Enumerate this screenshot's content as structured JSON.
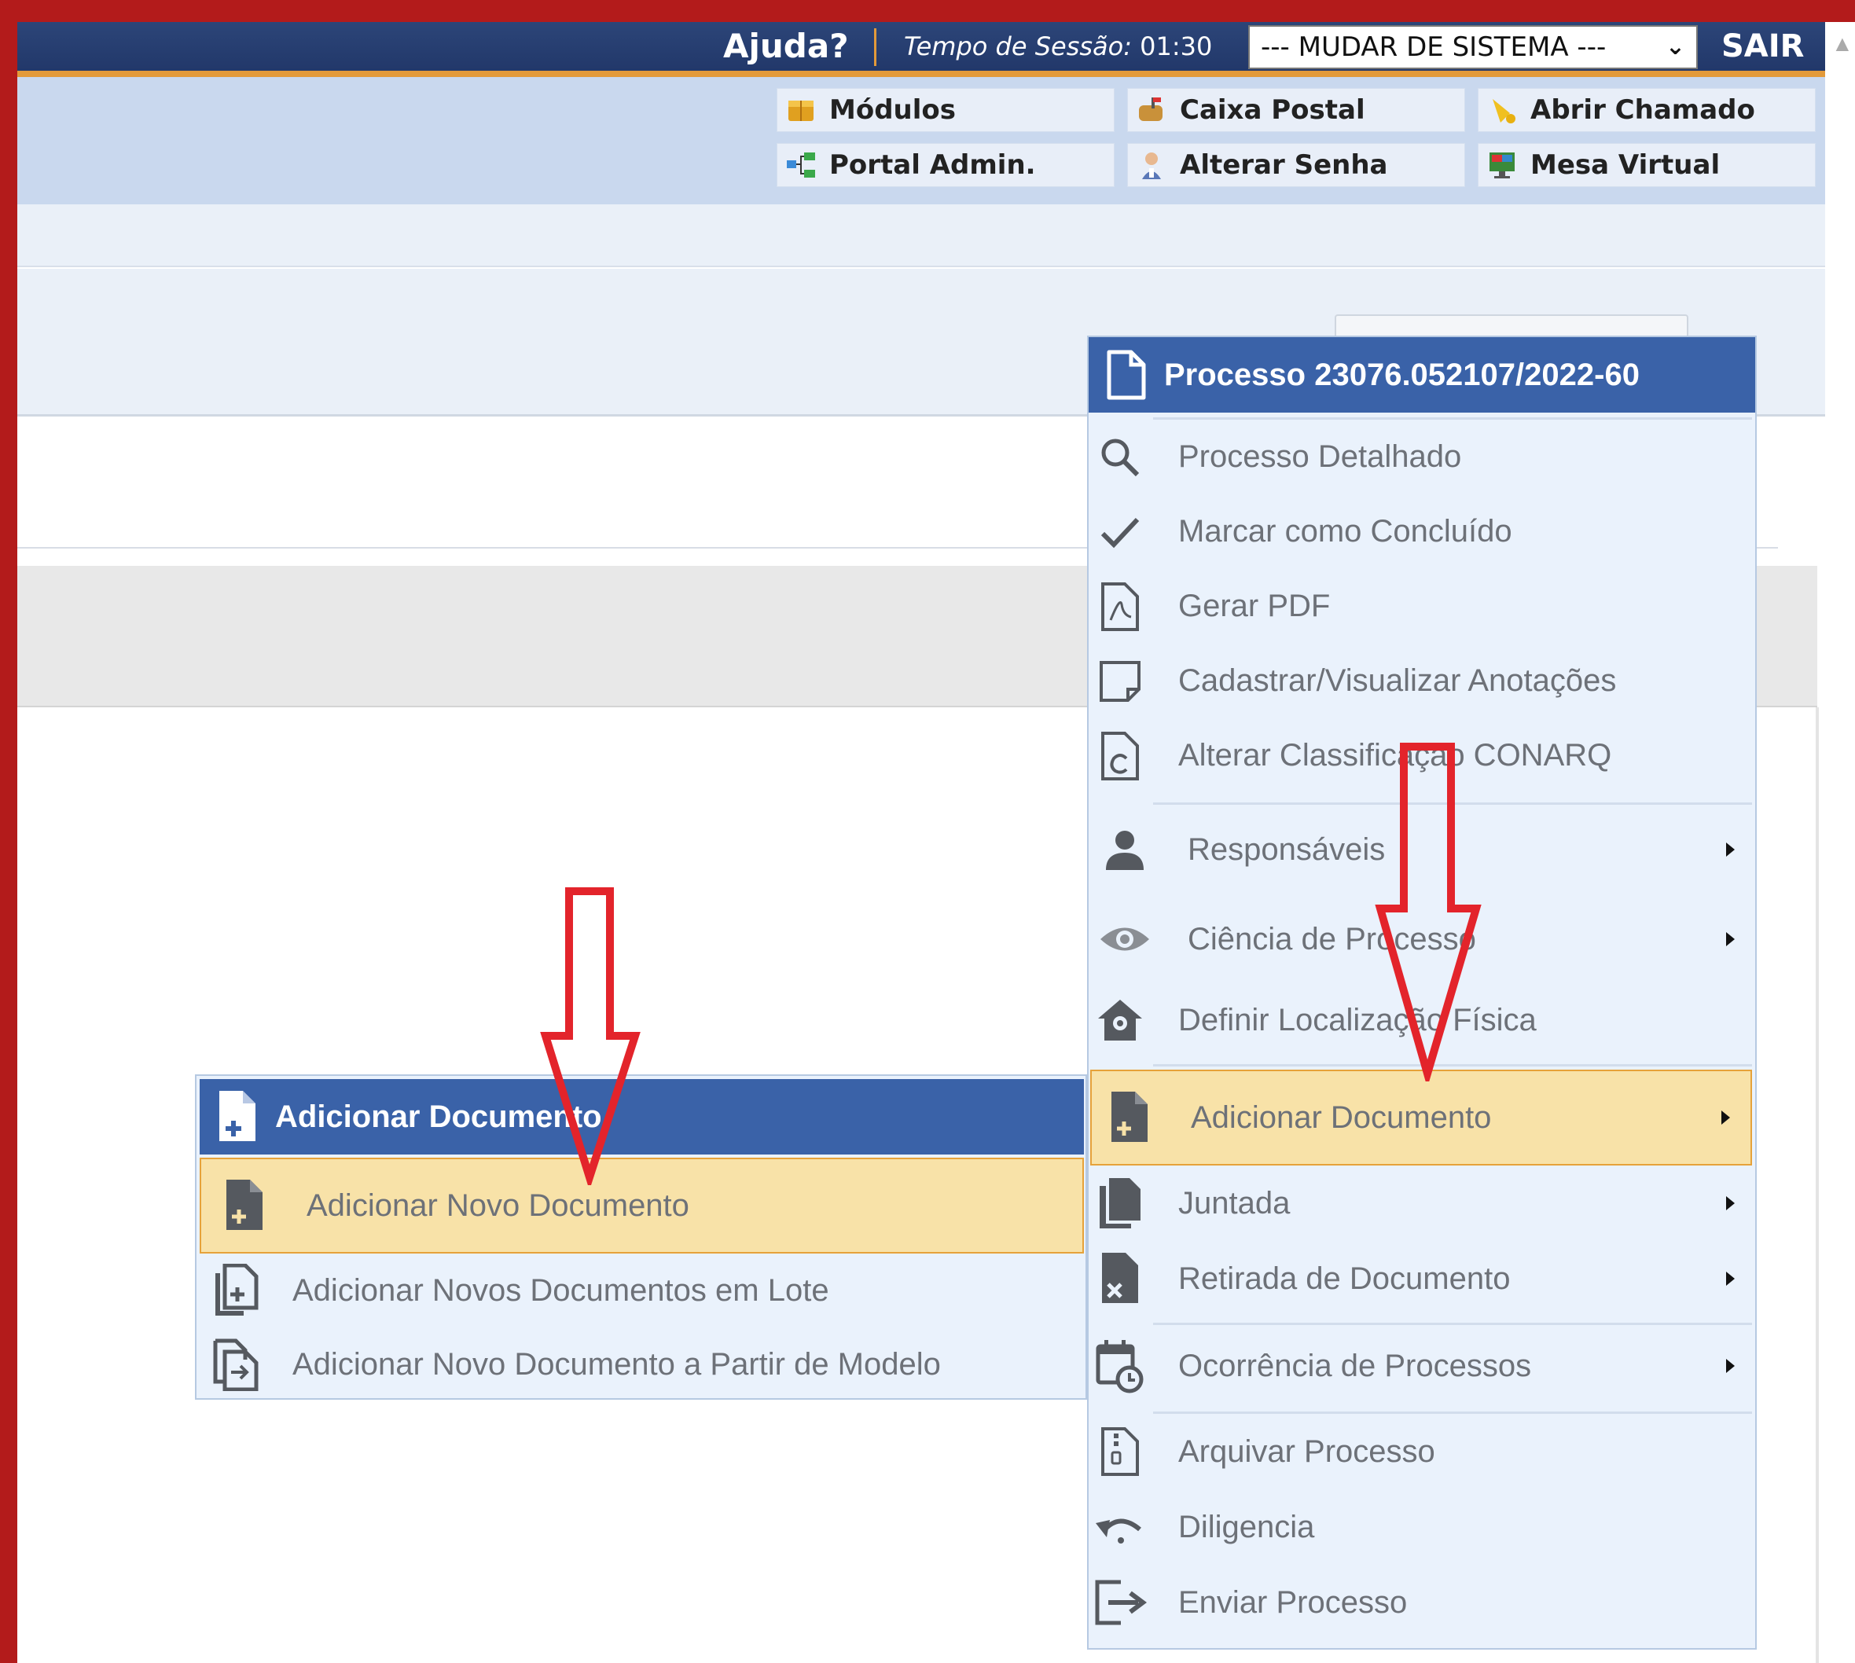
{
  "topbar": {
    "help": "Ajuda?",
    "session_label": "Tempo de Sessão:",
    "session_time": "01:30",
    "system_select": "--- MUDAR DE SISTEMA ---",
    "logout": "SAIR"
  },
  "header_buttons": [
    {
      "label": "Módulos",
      "icon": "modules-icon"
    },
    {
      "label": "Caixa Postal",
      "icon": "mailbox-icon"
    },
    {
      "label": "Abrir Chamado",
      "icon": "bell-icon"
    },
    {
      "label": "Portal Admin.",
      "icon": "network-icon"
    },
    {
      "label": "Alterar Senha",
      "icon": "user-key-icon"
    },
    {
      "label": "Mesa Virtual",
      "icon": "monitor-icon"
    }
  ],
  "process_menu": {
    "title": "Processo 23076.052107/2022-60",
    "items": [
      {
        "label": "Processo Detalhado",
        "icon": "search-icon"
      },
      {
        "label": "Marcar como Concluído",
        "icon": "check-icon"
      },
      {
        "label": "Gerar PDF",
        "icon": "pdf-icon"
      },
      {
        "label": "Cadastrar/Visualizar Anotações",
        "icon": "note-icon"
      },
      {
        "label": "Alterar Classificação CONARQ",
        "icon": "document-c-icon"
      },
      {
        "label": "Responsáveis",
        "icon": "person-icon"
      },
      {
        "label": "Ciência de Processo",
        "icon": "eye-icon"
      },
      {
        "label": "Definir Localização Física",
        "icon": "home-pin-icon"
      },
      {
        "label": "Adicionar Documento",
        "icon": "document-plus-icon"
      },
      {
        "label": "Juntada",
        "icon": "copy-icon"
      },
      {
        "label": "Retirada de Documento",
        "icon": "document-x-icon"
      },
      {
        "label": "Ocorrência de Processos",
        "icon": "calendar-clock-icon"
      },
      {
        "label": "Arquivar Processo",
        "icon": "archive-file-icon"
      },
      {
        "label": "Diligencia",
        "icon": "undo-icon"
      },
      {
        "label": "Enviar Processo",
        "icon": "send-icon"
      }
    ]
  },
  "submenu": {
    "title": "Adicionar Documento",
    "items": [
      {
        "label": "Adicionar Novo Documento",
        "icon": "document-plus-icon"
      },
      {
        "label": "Adicionar Novos Documentos em Lote",
        "icon": "documents-plus-icon"
      },
      {
        "label": "Adicionar Novo Documento a Partir de Modelo",
        "icon": "document-template-icon"
      }
    ]
  },
  "colors": {
    "frame": "#b31b1b",
    "topbar": "#22386a",
    "accent_orange": "#e39a3a",
    "menu_header": "#3a62a8",
    "highlight": "#f8e2a8",
    "annotation_arrow": "#e3242b"
  }
}
